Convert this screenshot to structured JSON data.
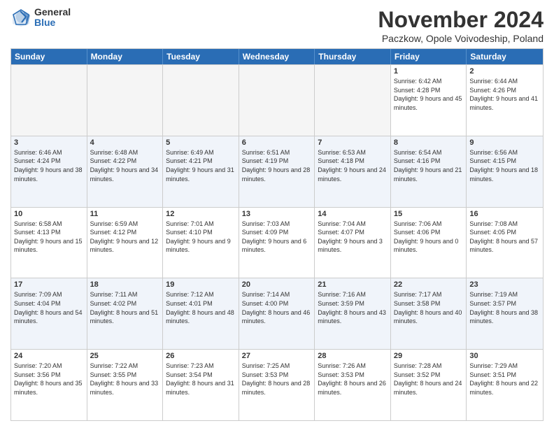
{
  "logo": {
    "general": "General",
    "blue": "Blue"
  },
  "title": "November 2024",
  "subtitle": "Paczkow, Opole Voivodeship, Poland",
  "headers": [
    "Sunday",
    "Monday",
    "Tuesday",
    "Wednesday",
    "Thursday",
    "Friday",
    "Saturday"
  ],
  "rows": [
    [
      {
        "day": "",
        "info": "",
        "empty": true
      },
      {
        "day": "",
        "info": "",
        "empty": true
      },
      {
        "day": "",
        "info": "",
        "empty": true
      },
      {
        "day": "",
        "info": "",
        "empty": true
      },
      {
        "day": "",
        "info": "",
        "empty": true
      },
      {
        "day": "1",
        "info": "Sunrise: 6:42 AM\nSunset: 4:28 PM\nDaylight: 9 hours\nand 45 minutes."
      },
      {
        "day": "2",
        "info": "Sunrise: 6:44 AM\nSunset: 4:26 PM\nDaylight: 9 hours\nand 41 minutes."
      }
    ],
    [
      {
        "day": "3",
        "info": "Sunrise: 6:46 AM\nSunset: 4:24 PM\nDaylight: 9 hours\nand 38 minutes."
      },
      {
        "day": "4",
        "info": "Sunrise: 6:48 AM\nSunset: 4:22 PM\nDaylight: 9 hours\nand 34 minutes."
      },
      {
        "day": "5",
        "info": "Sunrise: 6:49 AM\nSunset: 4:21 PM\nDaylight: 9 hours\nand 31 minutes."
      },
      {
        "day": "6",
        "info": "Sunrise: 6:51 AM\nSunset: 4:19 PM\nDaylight: 9 hours\nand 28 minutes."
      },
      {
        "day": "7",
        "info": "Sunrise: 6:53 AM\nSunset: 4:18 PM\nDaylight: 9 hours\nand 24 minutes."
      },
      {
        "day": "8",
        "info": "Sunrise: 6:54 AM\nSunset: 4:16 PM\nDaylight: 9 hours\nand 21 minutes."
      },
      {
        "day": "9",
        "info": "Sunrise: 6:56 AM\nSunset: 4:15 PM\nDaylight: 9 hours\nand 18 minutes."
      }
    ],
    [
      {
        "day": "10",
        "info": "Sunrise: 6:58 AM\nSunset: 4:13 PM\nDaylight: 9 hours\nand 15 minutes."
      },
      {
        "day": "11",
        "info": "Sunrise: 6:59 AM\nSunset: 4:12 PM\nDaylight: 9 hours\nand 12 minutes."
      },
      {
        "day": "12",
        "info": "Sunrise: 7:01 AM\nSunset: 4:10 PM\nDaylight: 9 hours\nand 9 minutes."
      },
      {
        "day": "13",
        "info": "Sunrise: 7:03 AM\nSunset: 4:09 PM\nDaylight: 9 hours\nand 6 minutes."
      },
      {
        "day": "14",
        "info": "Sunrise: 7:04 AM\nSunset: 4:07 PM\nDaylight: 9 hours\nand 3 minutes."
      },
      {
        "day": "15",
        "info": "Sunrise: 7:06 AM\nSunset: 4:06 PM\nDaylight: 9 hours\nand 0 minutes."
      },
      {
        "day": "16",
        "info": "Sunrise: 7:08 AM\nSunset: 4:05 PM\nDaylight: 8 hours\nand 57 minutes."
      }
    ],
    [
      {
        "day": "17",
        "info": "Sunrise: 7:09 AM\nSunset: 4:04 PM\nDaylight: 8 hours\nand 54 minutes."
      },
      {
        "day": "18",
        "info": "Sunrise: 7:11 AM\nSunset: 4:02 PM\nDaylight: 8 hours\nand 51 minutes."
      },
      {
        "day": "19",
        "info": "Sunrise: 7:12 AM\nSunset: 4:01 PM\nDaylight: 8 hours\nand 48 minutes."
      },
      {
        "day": "20",
        "info": "Sunrise: 7:14 AM\nSunset: 4:00 PM\nDaylight: 8 hours\nand 46 minutes."
      },
      {
        "day": "21",
        "info": "Sunrise: 7:16 AM\nSunset: 3:59 PM\nDaylight: 8 hours\nand 43 minutes."
      },
      {
        "day": "22",
        "info": "Sunrise: 7:17 AM\nSunset: 3:58 PM\nDaylight: 8 hours\nand 40 minutes."
      },
      {
        "day": "23",
        "info": "Sunrise: 7:19 AM\nSunset: 3:57 PM\nDaylight: 8 hours\nand 38 minutes."
      }
    ],
    [
      {
        "day": "24",
        "info": "Sunrise: 7:20 AM\nSunset: 3:56 PM\nDaylight: 8 hours\nand 35 minutes."
      },
      {
        "day": "25",
        "info": "Sunrise: 7:22 AM\nSunset: 3:55 PM\nDaylight: 8 hours\nand 33 minutes."
      },
      {
        "day": "26",
        "info": "Sunrise: 7:23 AM\nSunset: 3:54 PM\nDaylight: 8 hours\nand 31 minutes."
      },
      {
        "day": "27",
        "info": "Sunrise: 7:25 AM\nSunset: 3:53 PM\nDaylight: 8 hours\nand 28 minutes."
      },
      {
        "day": "28",
        "info": "Sunrise: 7:26 AM\nSunset: 3:53 PM\nDaylight: 8 hours\nand 26 minutes."
      },
      {
        "day": "29",
        "info": "Sunrise: 7:28 AM\nSunset: 3:52 PM\nDaylight: 8 hours\nand 24 minutes."
      },
      {
        "day": "30",
        "info": "Sunrise: 7:29 AM\nSunset: 3:51 PM\nDaylight: 8 hours\nand 22 minutes."
      }
    ]
  ]
}
